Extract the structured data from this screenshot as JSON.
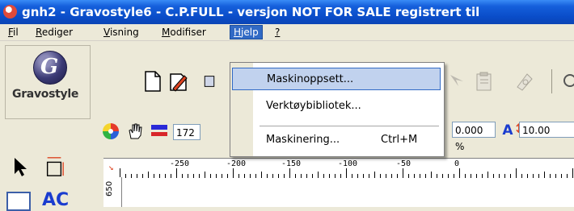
{
  "window": {
    "title": "gnh2 - Gravostyle6  - C.P.FULL - versjon NOT FOR SALE registrert til"
  },
  "menubar": {
    "items": [
      {
        "label": "Fil",
        "u": "F",
        "rest": "il"
      },
      {
        "label": "Rediger",
        "u": "R",
        "rest": "ediger"
      },
      {
        "label": "Visning",
        "u": "V",
        "rest": "isning"
      },
      {
        "label": "Modifiser",
        "u": "M",
        "rest": "odifiser"
      },
      {
        "label": "Hjelp",
        "u": "H",
        "rest": "jelp"
      },
      {
        "label": "?",
        "u": "?",
        "rest": ""
      }
    ],
    "active": "Hjelp"
  },
  "logo": {
    "text": "Gravostyle",
    "mark": "G"
  },
  "toolbar": {
    "size_input": "172",
    "percent_input": "0.000 %",
    "spacing_input": "10.00"
  },
  "dropdown": {
    "items": [
      {
        "label": "Maskinoppsett...",
        "shortcut": ""
      },
      {
        "label": "Verktøybibliotek...",
        "shortcut": ""
      },
      {
        "label": "Maskinering...",
        "shortcut": "Ctrl+M"
      }
    ]
  },
  "ruler": {
    "labels": [
      "-250",
      "-200",
      "-150",
      "-100",
      "-50",
      "0"
    ],
    "vertical_label": "650"
  },
  "colors": {
    "titlebar": "#0a4cc8",
    "menu_highlight": "#316ac5",
    "dropdown_highlight": "#c1d2ee"
  }
}
